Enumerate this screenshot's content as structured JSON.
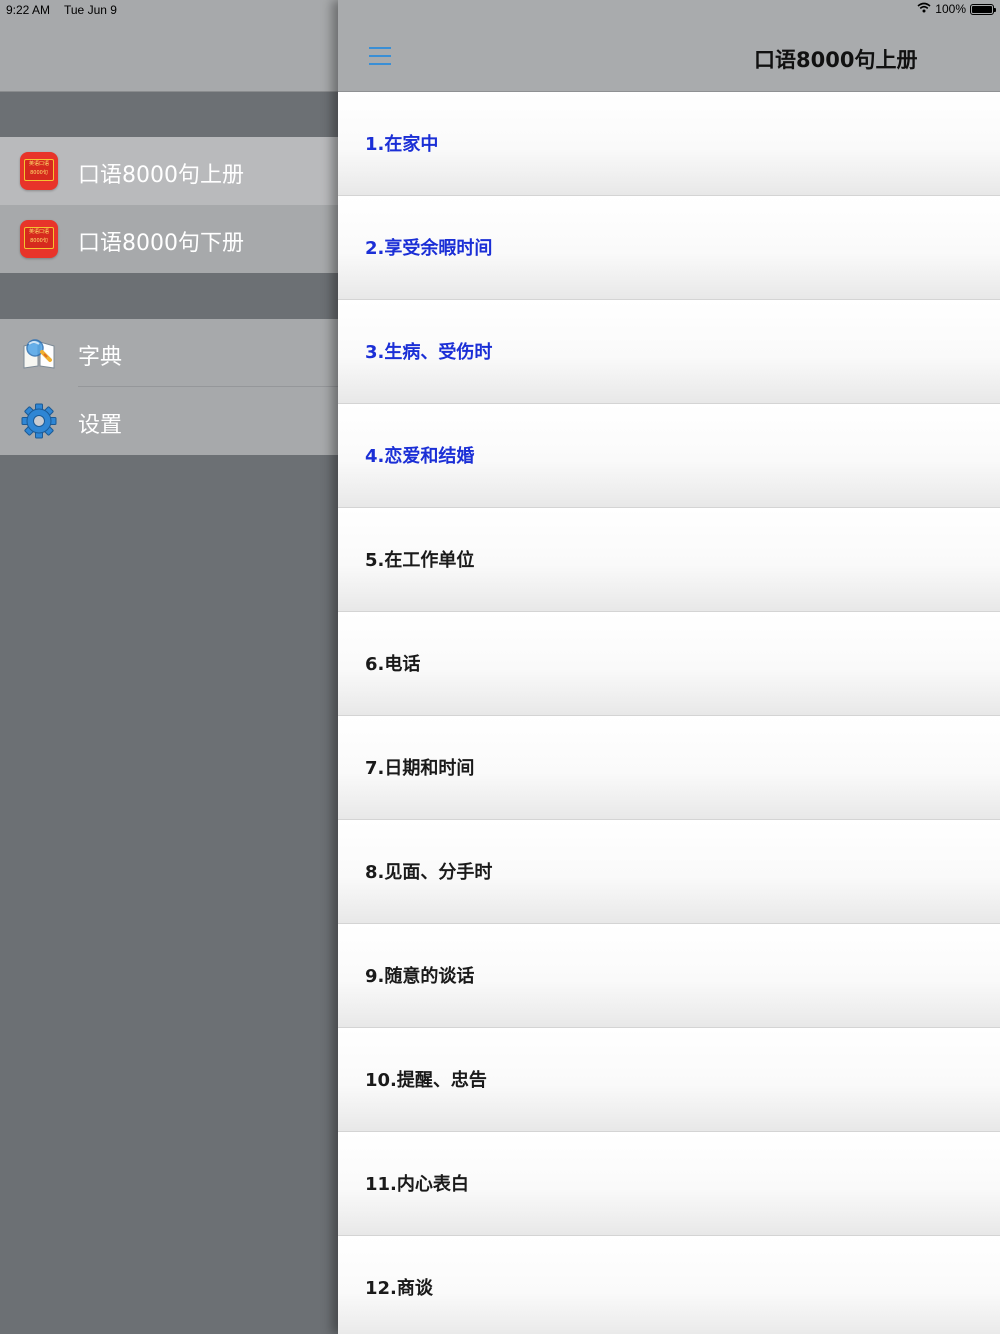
{
  "status_bar": {
    "time": "9:22 AM",
    "date": "Tue Jun 9",
    "battery_percent": "100%",
    "battery_level": 1.0,
    "wifi_icon": "wifi-icon"
  },
  "sidebar": {
    "books": [
      {
        "label": "口语8000句上册",
        "icon": "app-icon",
        "icon_text": "英语口语 8000句",
        "selected": true
      },
      {
        "label": "口语8000句下册",
        "icon": "app-icon",
        "icon_text": "英语口语 8000句",
        "selected": false
      }
    ],
    "tools": [
      {
        "label": "字典",
        "icon": "dictionary-icon"
      },
      {
        "label": "设置",
        "icon": "gear-icon"
      }
    ]
  },
  "main": {
    "title": "口语8000句上册",
    "menu_icon": "hamburger-menu-icon",
    "accent_color": "#3a8fd6",
    "read_color": "#1b2fd6",
    "chapters": [
      {
        "label": "1.在家中",
        "read": true
      },
      {
        "label": "2.享受余暇时间",
        "read": true
      },
      {
        "label": "3.生病、受伤时",
        "read": true
      },
      {
        "label": "4.恋爱和结婚",
        "read": true
      },
      {
        "label": "5.在工作单位",
        "read": false
      },
      {
        "label": "6.电话",
        "read": false
      },
      {
        "label": "7.日期和时间",
        "read": false
      },
      {
        "label": "8.见面、分手时",
        "read": false
      },
      {
        "label": "9.随意的谈话",
        "read": false
      },
      {
        "label": "10.提醒、忠告",
        "read": false
      },
      {
        "label": "11.内心表白",
        "read": false
      },
      {
        "label": "12.商谈",
        "read": false
      }
    ]
  }
}
